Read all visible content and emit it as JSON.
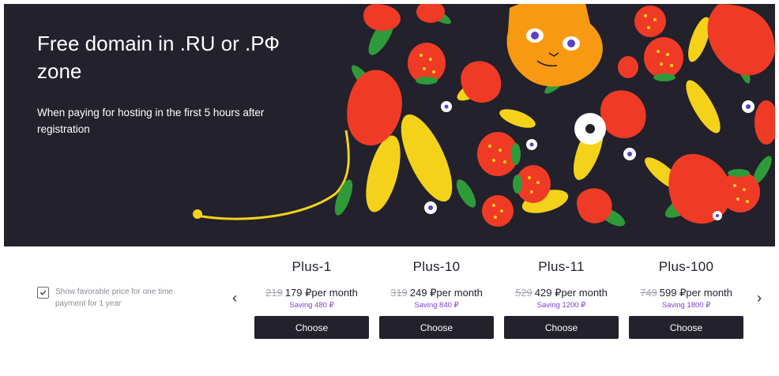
{
  "banner": {
    "title": "Free domain in .RU or .РФ zone",
    "subtitle": "When paying for hosting in the first 5 hours after registration"
  },
  "option": {
    "checked": true,
    "label": "Show favorable price for one time payment for 1 year"
  },
  "nav": {
    "prev_icon": "‹",
    "next_icon": "›"
  },
  "plans": [
    {
      "name": "Plus-1",
      "old_price": "219",
      "price": "179 ₽per month",
      "saving": "Saving 480 ₽",
      "button": "Choose"
    },
    {
      "name": "Plus-10",
      "old_price": "319",
      "price": "249 ₽per month",
      "saving": "Saving 840 ₽",
      "button": "Choose"
    },
    {
      "name": "Plus-11",
      "old_price": "529",
      "price": "429 ₽per month",
      "saving": "Saving 1200 ₽",
      "button": "Choose"
    },
    {
      "name": "Plus-100",
      "old_price": "749",
      "price": "599 ₽per month",
      "saving": "Saving 1800 ₽",
      "button": "Choose"
    }
  ],
  "colors": {
    "banner_bg": "#22212c",
    "accent_purple": "#7a3fd0",
    "button_bg": "#22212c",
    "strike_gray": "#a6a6b0"
  }
}
